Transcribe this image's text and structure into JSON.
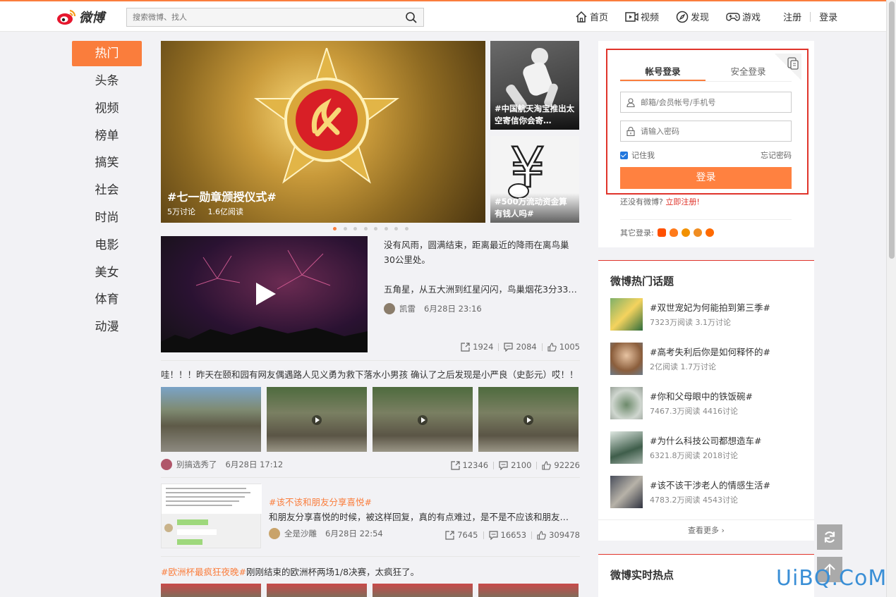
{
  "header": {
    "logo_text": "微博",
    "search_placeholder": "搜索微博、找人",
    "nav": [
      {
        "label": "首页",
        "icon": "home-icon"
      },
      {
        "label": "视频",
        "icon": "video-icon"
      },
      {
        "label": "发现",
        "icon": "compass-icon"
      },
      {
        "label": "游戏",
        "icon": "gamepad-icon"
      }
    ],
    "register": "注册",
    "login": "登录"
  },
  "leftnav": [
    "热门",
    "头条",
    "视频",
    "榜单",
    "搞笑",
    "社会",
    "时尚",
    "电影",
    "美女",
    "体育",
    "动漫"
  ],
  "hero": {
    "title": "#七一勋章颁授仪式#",
    "discussions": "5万讨论",
    "reads": "1.6亿阅读"
  },
  "side_cards": [
    "#中国航天淘宝推出太空寄信你会寄…",
    "#500万流动资金算有钱人吗#"
  ],
  "video_post": {
    "text1": "没有风雨，圆满结束，距离最近的降雨在离鸟巢30公里处。",
    "text2": "五角星，从五大洲到红星闪闪，鸟巢烟花3分33…",
    "author": "凯雷",
    "time": "6月28日 23:16",
    "share": "1924",
    "comment": "2084",
    "like": "1005"
  },
  "post2": {
    "text": "哇！！！昨天在颐和园有网友偶遇路人见义勇为救下落水小男孩 确认了之后发现是小严良（史彭元）哎！！",
    "author": "别搞选秀了",
    "time": "6月28日 17:12",
    "share": "12346",
    "comment": "2100",
    "like": "92226"
  },
  "post3": {
    "tag": "#该不该和朋友分享喜悦#",
    "desc": "和朋友分享喜悦的时候，被这样回复，真的有点难过，是不是不应该和朋友…",
    "author": "全是沙雕",
    "time": "6月28日 22:54",
    "share": "7645",
    "comment": "16653",
    "like": "309478"
  },
  "post4": {
    "tag": "#欧洲杯最疯狂夜晚#",
    "text": "刚刚结束的欧洲杯两场1/8决赛，太疯狂了。"
  },
  "login": {
    "tab_account": "帐号登录",
    "tab_secure": "安全登录",
    "user_placeholder": "邮箱/会员帐号/手机号",
    "pass_placeholder": "请输入密码",
    "remember": "记住我",
    "forgot": "忘记密码",
    "submit": "登录",
    "no_account": "还没有微博?",
    "register_now": "立即注册!",
    "other_login": "其它登录:"
  },
  "hot_topics": {
    "title": "微博热门话题",
    "items": [
      {
        "name": "#双世宠妃为何能拍到第三季#",
        "meta": "7323万阅读 3.1万讨论"
      },
      {
        "name": "#高考失利后你是如何释怀的#",
        "meta": "2亿阅读 1.7万讨论"
      },
      {
        "name": "#你和父母眼中的铁饭碗#",
        "meta": "7467.3万阅读 4416讨论"
      },
      {
        "name": "#为什么科技公司都想造车#",
        "meta": "6321.8万阅读 2018讨论"
      },
      {
        "name": "#该不该干涉老人的情感生活#",
        "meta": "4783.2万阅读 4543讨论"
      }
    ],
    "more": "查看更多 ›"
  },
  "realtime": {
    "title": "微博实时热点"
  },
  "watermark": "UiBQ.CoM",
  "colors": {
    "accent": "#fa7d3c",
    "highlight": "#e0342b",
    "login_button": "#ff8140"
  }
}
